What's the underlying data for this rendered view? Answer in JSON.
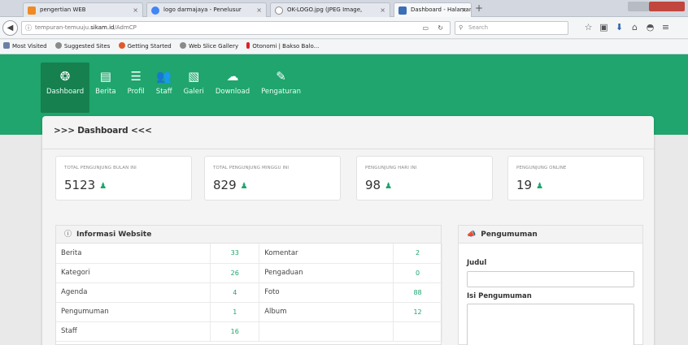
{
  "browser": {
    "tabs": [
      {
        "label": "pengertian WEB",
        "color": "#f08a24"
      },
      {
        "label": "logo darmajaya - Penelusur",
        "color": "#4285f4"
      },
      {
        "label": "OK-LOGO.jpg (JPEG Image,",
        "color": "#888888"
      },
      {
        "label": "Dashboard - Halaman Admi",
        "color": "#3b6fb6"
      }
    ],
    "url_prefix": "tempuran-temuuju.",
    "url_host": "sikam.id",
    "url_path": "/AdmCP",
    "search_placeholder": "Search",
    "bookmarks": [
      {
        "label": "Most Visited",
        "color": "#6b7fa6"
      },
      {
        "label": "Suggested Sites",
        "color": "#8a8a8a"
      },
      {
        "label": "Getting Started",
        "color": "#e05a2b"
      },
      {
        "label": "Web Slice Gallery",
        "color": "#8a8a8a"
      },
      {
        "label": "Otonomi | Bakso Balo...",
        "color": "#d22"
      }
    ]
  },
  "menu": [
    {
      "label": "Dashboard",
      "icon": "tachometer-icon",
      "glyph": "❂"
    },
    {
      "label": "Berita",
      "icon": "file-icon",
      "glyph": "▤"
    },
    {
      "label": "Profil",
      "icon": "list-icon",
      "glyph": "☰"
    },
    {
      "label": "Staff",
      "icon": "users-icon",
      "glyph": "👥"
    },
    {
      "label": "Galeri",
      "icon": "image-icon",
      "glyph": "▧"
    },
    {
      "label": "Download",
      "icon": "cloud-download-icon",
      "glyph": "☁"
    },
    {
      "label": "Pengaturan",
      "icon": "wrench-icon",
      "glyph": "✎"
    }
  ],
  "accent": "#1fa56d",
  "dashboard": {
    "title": ">>> Dashboard <<<",
    "stats": [
      {
        "caption": "TOTAL PENGUNJUNG BULAN INI",
        "value": "5123"
      },
      {
        "caption": "TOTAL PENGUNJUNG MINGGU INI",
        "value": "829"
      },
      {
        "caption": "PENGUNJUNG HARI INI",
        "value": "98"
      },
      {
        "caption": "PENGUNJUNG ONLINE",
        "value": "19"
      }
    ],
    "info_title": "Informasi Website",
    "info_rows": [
      {
        "label1": "Berita",
        "value1": "33",
        "label2": "Komentar",
        "value2": "2"
      },
      {
        "label1": "Kategori",
        "value1": "26",
        "label2": "Pengaduan",
        "value2": "0"
      },
      {
        "label1": "Agenda",
        "value1": "4",
        "label2": "Foto",
        "value2": "88"
      },
      {
        "label1": "Pengumuman",
        "value1": "1",
        "label2": "Album",
        "value2": "12"
      },
      {
        "label1": "Staff",
        "value1": "16",
        "label2": "",
        "value2": ""
      }
    ],
    "announcement_title": "Pengumuman",
    "judul_label": "Judul",
    "judul_value": "",
    "isi_label": "Isi Pengumuman",
    "isi_value": ""
  }
}
